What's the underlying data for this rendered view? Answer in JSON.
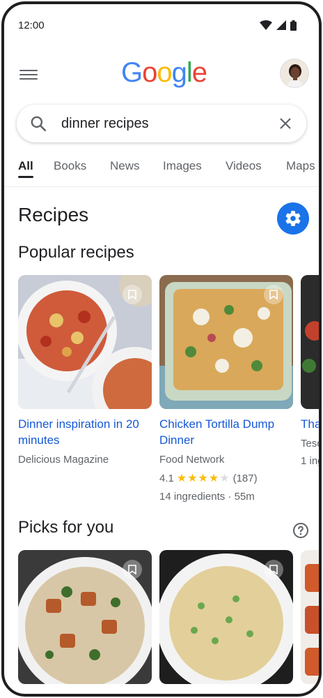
{
  "status": {
    "time": "12:00"
  },
  "header": {
    "logo_letters": [
      "G",
      "o",
      "o",
      "g",
      "l",
      "e"
    ],
    "logo_colors": [
      "#4285F4",
      "#EA4335",
      "#FBBC05",
      "#4285F4",
      "#34A853",
      "#EA4335"
    ]
  },
  "search": {
    "query": "dinner recipes"
  },
  "tabs": [
    {
      "label": "All",
      "active": true
    },
    {
      "label": "Books"
    },
    {
      "label": "News"
    },
    {
      "label": "Images"
    },
    {
      "label": "Videos"
    },
    {
      "label": "Maps"
    }
  ],
  "recipes": {
    "title": "Recipes",
    "popular_title": "Popular recipes",
    "cards": [
      {
        "title": "Dinner inspiration in 20 minutes",
        "source": "Delicious Magazine"
      },
      {
        "title": "Chicken Tortilla Dump Dinner",
        "source": "Food Network",
        "rating": "4.1",
        "stars": 4,
        "reviews": "(187)",
        "meta": "14 ingredients · 55m"
      },
      {
        "title": "Tha",
        "source": "Tesc",
        "meta": "1 ing"
      }
    ]
  },
  "picks": {
    "title": "Picks for you"
  },
  "colors": {
    "accent": "#1a73e8",
    "link": "#1558d6",
    "star": "#fbbc04"
  }
}
